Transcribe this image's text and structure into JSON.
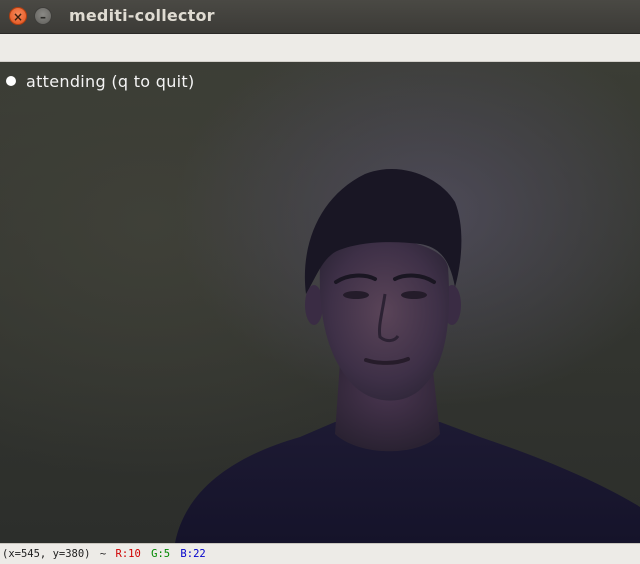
{
  "window": {
    "title": "mediti-collector",
    "close_glyph": "×",
    "minimize_glyph": "–"
  },
  "overlay": {
    "status_text": "attending (q to quit)"
  },
  "statusbar": {
    "coords": "(x=545, y=380)",
    "separator": "~",
    "r": "R:10",
    "g": "G:5",
    "b": "B:22"
  },
  "colors": {
    "close_button": "#e2501a",
    "r_value": "#d00000",
    "g_value": "#008800",
    "b_value": "#0000cc"
  },
  "icons": {
    "close": "close-icon",
    "minimize": "minimize-icon"
  }
}
